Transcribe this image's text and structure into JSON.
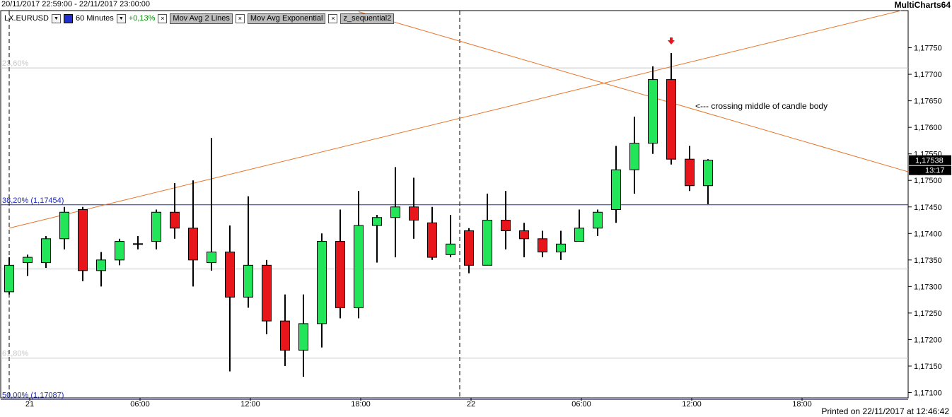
{
  "header": {
    "date_range": "20/11/2017 22:59:00 - 22/11/2017 23:00:00",
    "brand": "MultiCharts64"
  },
  "toolbar": {
    "symbol": "LX.EURUSD",
    "interval": "60 Minutes",
    "change": "+0,13%",
    "studies": [
      "Mov Avg 2 Lines",
      "Mov Avg Exponential",
      "z_sequential2"
    ]
  },
  "footer": {
    "printed": "Printed on 22/11/2017 at 12:46:42"
  },
  "colors": {
    "up": "#22e55a",
    "down": "#e8151b",
    "trendline": "#e8742a",
    "fib_blue": "#1e2ab8",
    "axis": "#000000"
  },
  "chart_data": {
    "type": "candlestick",
    "ylim": [
      1.1709,
      1.1782
    ],
    "y_ticks": [
      "1,17100",
      "1,17150",
      "1,17200",
      "1,17250",
      "1,17300",
      "1,17350",
      "1,17400",
      "1,17450",
      "1,17500",
      "1,17550",
      "1,17600",
      "1,17650",
      "1,17700",
      "1,17750"
    ],
    "x_ticks": [
      {
        "label": "21",
        "bar": 1
      },
      {
        "label": "06:00",
        "bar": 7
      },
      {
        "label": "12:00",
        "bar": 13
      },
      {
        "label": "18:00",
        "bar": 19
      },
      {
        "label": "22",
        "bar": 25
      },
      {
        "label": "06:00",
        "bar": 31
      },
      {
        "label": "12:00",
        "bar": 37
      },
      {
        "label": "18:00",
        "bar": 43
      }
    ],
    "candles": [
      {
        "o": 1.1729,
        "h": 1.17355,
        "l": 1.17285,
        "c": 1.1734
      },
      {
        "o": 1.17345,
        "h": 1.1736,
        "l": 1.1732,
        "c": 1.17355
      },
      {
        "o": 1.17345,
        "h": 1.17395,
        "l": 1.17335,
        "c": 1.1739
      },
      {
        "o": 1.1739,
        "h": 1.1745,
        "l": 1.1737,
        "c": 1.1744
      },
      {
        "o": 1.17445,
        "h": 1.1745,
        "l": 1.1731,
        "c": 1.1733
      },
      {
        "o": 1.1733,
        "h": 1.17365,
        "l": 1.173,
        "c": 1.1735
      },
      {
        "o": 1.1735,
        "h": 1.1739,
        "l": 1.1734,
        "c": 1.17385
      },
      {
        "o": 1.1738,
        "h": 1.17395,
        "l": 1.1737,
        "c": 1.1738
      },
      {
        "o": 1.17385,
        "h": 1.17445,
        "l": 1.1737,
        "c": 1.1744
      },
      {
        "o": 1.1744,
        "h": 1.17495,
        "l": 1.1739,
        "c": 1.1741
      },
      {
        "o": 1.1741,
        "h": 1.175,
        "l": 1.173,
        "c": 1.1735
      },
      {
        "o": 1.17345,
        "h": 1.1758,
        "l": 1.1733,
        "c": 1.17365
      },
      {
        "o": 1.17365,
        "h": 1.17415,
        "l": 1.1714,
        "c": 1.1728
      },
      {
        "o": 1.1728,
        "h": 1.1747,
        "l": 1.1726,
        "c": 1.1734
      },
      {
        "o": 1.1734,
        "h": 1.1735,
        "l": 1.1721,
        "c": 1.17235
      },
      {
        "o": 1.17235,
        "h": 1.17285,
        "l": 1.1715,
        "c": 1.1718
      },
      {
        "o": 1.1718,
        "h": 1.17285,
        "l": 1.1713,
        "c": 1.1723
      },
      {
        "o": 1.1723,
        "h": 1.174,
        "l": 1.17185,
        "c": 1.17385
      },
      {
        "o": 1.17385,
        "h": 1.17445,
        "l": 1.1724,
        "c": 1.1726
      },
      {
        "o": 1.1726,
        "h": 1.1748,
        "l": 1.1724,
        "c": 1.17415
      },
      {
        "o": 1.17415,
        "h": 1.17435,
        "l": 1.17345,
        "c": 1.1743
      },
      {
        "o": 1.1743,
        "h": 1.17525,
        "l": 1.17355,
        "c": 1.1745
      },
      {
        "o": 1.1745,
        "h": 1.17505,
        "l": 1.1739,
        "c": 1.17425
      },
      {
        "o": 1.1742,
        "h": 1.1745,
        "l": 1.1735,
        "c": 1.17355
      },
      {
        "o": 1.1736,
        "h": 1.17435,
        "l": 1.17355,
        "c": 1.1738
      },
      {
        "o": 1.17405,
        "h": 1.1741,
        "l": 1.17325,
        "c": 1.1734
      },
      {
        "o": 1.1734,
        "h": 1.17475,
        "l": 1.1734,
        "c": 1.17425
      },
      {
        "o": 1.17425,
        "h": 1.1748,
        "l": 1.1737,
        "c": 1.17405
      },
      {
        "o": 1.17405,
        "h": 1.1742,
        "l": 1.17355,
        "c": 1.1739
      },
      {
        "o": 1.1739,
        "h": 1.17405,
        "l": 1.17355,
        "c": 1.17365
      },
      {
        "o": 1.17365,
        "h": 1.17405,
        "l": 1.1735,
        "c": 1.1738
      },
      {
        "o": 1.17385,
        "h": 1.17445,
        "l": 1.17385,
        "c": 1.1741
      },
      {
        "o": 1.1741,
        "h": 1.17445,
        "l": 1.17395,
        "c": 1.1744
      },
      {
        "o": 1.17445,
        "h": 1.17565,
        "l": 1.1742,
        "c": 1.1752
      },
      {
        "o": 1.1752,
        "h": 1.1762,
        "l": 1.17475,
        "c": 1.1757
      },
      {
        "o": 1.1757,
        "h": 1.17715,
        "l": 1.1755,
        "c": 1.1769
      },
      {
        "o": 1.1769,
        "h": 1.1774,
        "l": 1.1753,
        "c": 1.1754
      },
      {
        "o": 1.1754,
        "h": 1.17565,
        "l": 1.1748,
        "c": 1.1749
      },
      {
        "o": 1.1749,
        "h": 1.1754,
        "l": 1.17455,
        "c": 1.17538
      }
    ],
    "horizontal_levels": [
      {
        "label": "23,60%",
        "value": 1.17712,
        "color": "#c8c8c8"
      },
      {
        "label": "38,20% (1,17454)",
        "value": 1.17454,
        "color": "#1e2ab8"
      },
      {
        "label": "",
        "value": 1.17333,
        "color": "#c8c8c8"
      },
      {
        "label": "61,80%",
        "value": 1.17165,
        "color": "#c8c8c8"
      },
      {
        "label": "50,00% (1,17087)",
        "value": 1.17087,
        "color": "#1e2ab8"
      }
    ],
    "trendlines": [
      {
        "from": {
          "bar": 0,
          "price": 1.1741
        },
        "to": {
          "bar": 48.5,
          "price": 1.1782
        }
      },
      {
        "from": {
          "bar": 19,
          "price": 1.17818
        },
        "to": {
          "bar": 49.5,
          "price": 1.1751
        }
      }
    ],
    "vertical_markers": [
      0,
      24.5
    ],
    "signal_arrow": {
      "bar": 36,
      "price": 1.1776
    },
    "annotation": "<--- crossing middle of candle body",
    "last_price": "1,17538",
    "countdown": "13:17"
  }
}
